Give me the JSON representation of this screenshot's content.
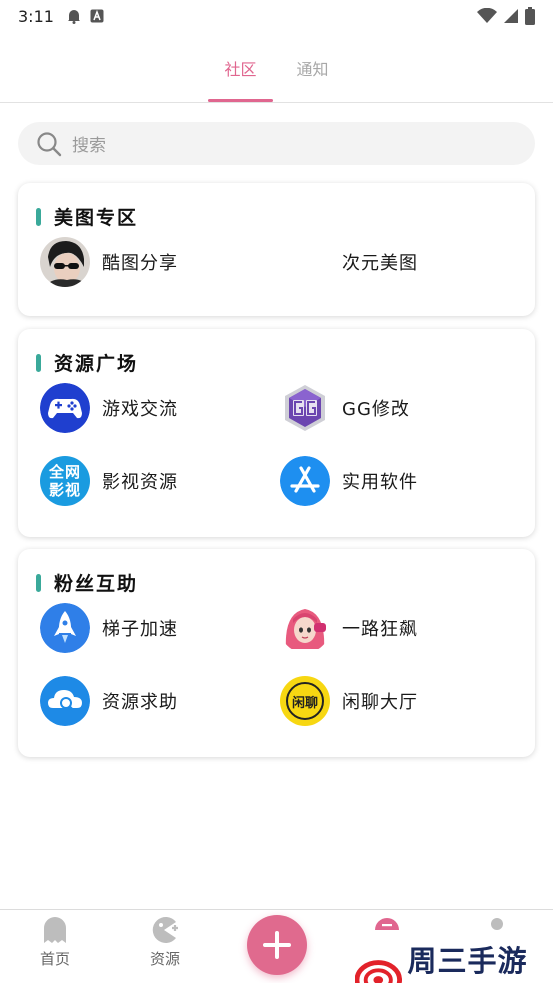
{
  "status_bar": {
    "time": "3:11"
  },
  "top_tabs": [
    {
      "label": "社区",
      "active": true
    },
    {
      "label": "通知",
      "active": false
    }
  ],
  "search": {
    "placeholder": "搜索"
  },
  "sections": [
    {
      "title": "美图专区",
      "items": [
        {
          "label": "酷图分享",
          "icon": "avatar-photo-icon"
        },
        {
          "label": "次元美图",
          "icon": ""
        }
      ]
    },
    {
      "title": "资源广场",
      "items": [
        {
          "label": "游戏交流",
          "icon": "gamepad-icon"
        },
        {
          "label": "GG修改",
          "icon": "gg-logo-icon"
        },
        {
          "label": "影视资源",
          "icon": "quanwang-yingshi-icon",
          "icon_text": [
            "全网",
            "影视"
          ]
        },
        {
          "label": "实用软件",
          "icon": "app-store-icon"
        }
      ]
    },
    {
      "title": "粉丝互助",
      "items": [
        {
          "label": "梯子加速",
          "icon": "rocket-icon"
        },
        {
          "label": "一路狂飙",
          "icon": "anime-girl-avatar-icon"
        },
        {
          "label": "资源求助",
          "icon": "cloud-search-icon"
        },
        {
          "label": "闲聊大厅",
          "icon": "xianliao-badge-icon",
          "icon_text": [
            "闲",
            "聊"
          ]
        }
      ]
    }
  ],
  "bottom_nav": [
    {
      "label": "首页",
      "icon": "ghost-icon"
    },
    {
      "label": "资源",
      "icon": "pacman-icon"
    },
    {
      "label": "",
      "icon": "plus-icon"
    }
  ],
  "watermark": {
    "text": "周三手游网"
  },
  "colors": {
    "accent": "#e0668f",
    "section_bar": "#3aa99a",
    "fab": "#e06a8e"
  }
}
